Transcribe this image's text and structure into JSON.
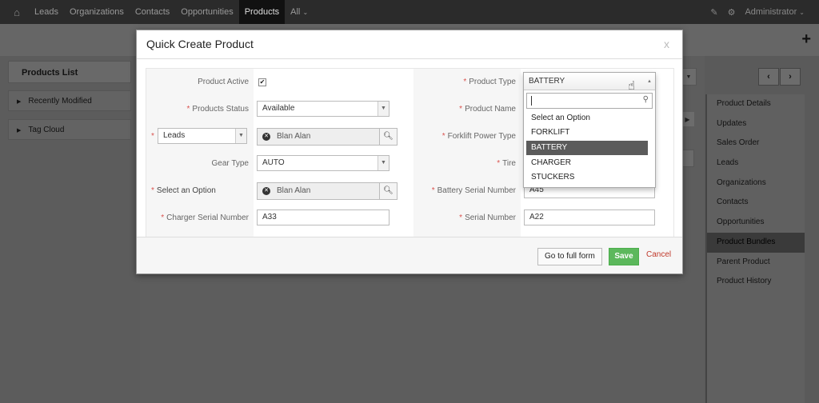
{
  "nav": {
    "items": [
      "Leads",
      "Organizations",
      "Contacts",
      "Opportunities",
      "Products",
      "All"
    ],
    "all_caret": "⌄",
    "user": "Administrator"
  },
  "left_panel": {
    "title": "Products List",
    "items": [
      "Recently Modified",
      "Tag Cloud"
    ]
  },
  "right_panel": {
    "items": [
      "Product Details",
      "Updates",
      "Sales Order",
      "Leads",
      "Organizations",
      "Contacts",
      "Opportunities",
      "Product Bundles",
      "Parent Product",
      "Product History"
    ],
    "active": "Product Bundles"
  },
  "modal": {
    "title": "Quick Create Product",
    "close": "x",
    "fields": {
      "product_active": {
        "label": "Product Active",
        "checked": true
      },
      "product_type": {
        "label": "Product Type",
        "value": "BATTERY"
      },
      "products_status": {
        "label": "Products Status",
        "value": "Available"
      },
      "product_name": {
        "label": "Product Name",
        "value": ""
      },
      "leads_type": {
        "value": "Leads"
      },
      "leads_ref": {
        "value": "Blan Alan"
      },
      "forklift_power_type": {
        "label": "Forklift Power Type"
      },
      "gear_type": {
        "label": "Gear Type",
        "value": "AUTO"
      },
      "tire": {
        "label": "Tire"
      },
      "select_option": {
        "label": "Select an Option",
        "value": "Blan Alan"
      },
      "battery_serial": {
        "label": "Battery Serial Number",
        "value": "A45"
      },
      "charger_serial": {
        "label": "Charger Serial Number",
        "value": "A33"
      },
      "serial_number": {
        "label": "Serial Number",
        "value": "A22"
      }
    },
    "footer": {
      "full_form": "Go to full form",
      "save": "Save",
      "cancel": "Cancel"
    }
  },
  "dropdown": {
    "selected": "BATTERY",
    "search_value": "",
    "options": [
      "Select an Option",
      "FORKLIFT",
      "BATTERY",
      "CHARGER",
      "STUCKERS"
    ],
    "highlighted_index": 2
  },
  "colors": {
    "nav_bg": "#2b2b2b",
    "save_green": "#5cb85c",
    "required_red": "#d9534f",
    "highlight": "#5b5b5b"
  }
}
